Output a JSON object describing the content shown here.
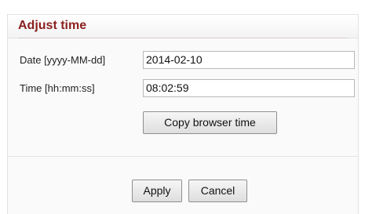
{
  "dialog": {
    "title": "Adjust time",
    "date_label": "Date [yyyy-MM-dd]",
    "date_value": "2014-02-10",
    "time_label": "Time [hh:mm:ss]",
    "time_value": "08:02:59",
    "copy_button": "Copy browser time",
    "apply_button": "Apply",
    "cancel_button": "Cancel"
  }
}
